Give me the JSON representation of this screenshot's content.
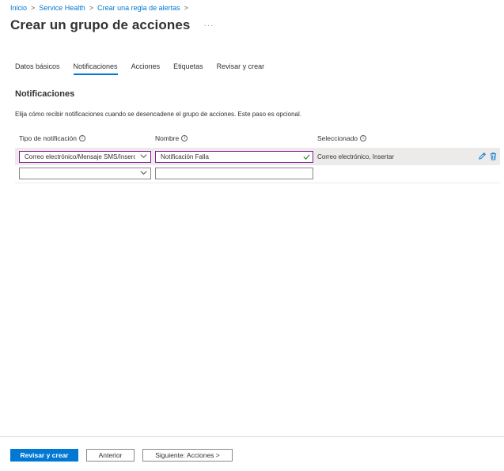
{
  "breadcrumb": {
    "items": [
      "Inicio",
      "Service Health",
      "Crear una regla de alertas"
    ],
    "separator": ">"
  },
  "page": {
    "title": "Crear un grupo de acciones",
    "more_label": "···"
  },
  "tabs": [
    {
      "label": "Datos básicos",
      "active": false
    },
    {
      "label": "Notificaciones",
      "active": true
    },
    {
      "label": "Acciones",
      "active": false
    },
    {
      "label": "Etiquetas",
      "active": false
    },
    {
      "label": "Revisar y crear",
      "active": false
    }
  ],
  "section": {
    "title": "Notificaciones",
    "description": "Elija cómo recibir notificaciones cuando se desencadene el grupo de acciones. Este paso es opcional."
  },
  "table": {
    "headers": {
      "type": "Tipo de notificación",
      "name": "Nombre",
      "selected": "Seleccionado"
    },
    "info_glyph": "i",
    "rows": [
      {
        "type": "Correo electrónico/Mensaje SMS/Inserción/Voz",
        "name": "Notificación Falla",
        "selected": "Correo electrónico, Insertar"
      },
      {
        "type": "",
        "name": "",
        "selected": ""
      }
    ]
  },
  "icons": {
    "edit": "pencil-icon",
    "delete": "trash-icon",
    "dropdown": "chevron-down-icon",
    "valid": "checkmark-icon"
  },
  "colors": {
    "accent": "#0078d4",
    "focus_border": "#881798",
    "row_highlight": "#edebe9"
  },
  "footer": {
    "review_create": "Revisar y crear",
    "previous": "Anterior",
    "next": "Siguiente: Acciones >"
  }
}
